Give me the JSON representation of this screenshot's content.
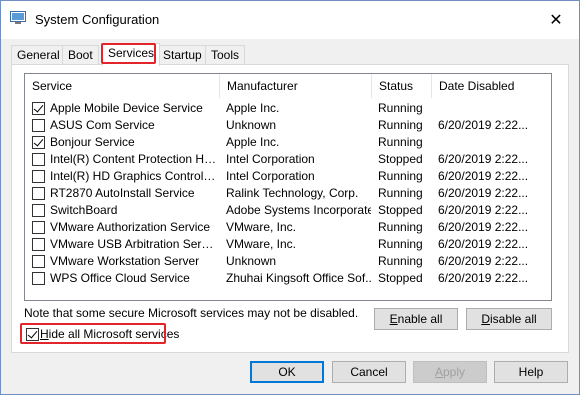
{
  "window": {
    "title": "System Configuration",
    "close_glyph": "✕"
  },
  "tabs": [
    {
      "label": "General",
      "active": false
    },
    {
      "label": "Boot",
      "active": false
    },
    {
      "label": "Services",
      "active": true
    },
    {
      "label": "Startup",
      "active": false
    },
    {
      "label": "Tools",
      "active": false
    }
  ],
  "services": {
    "columns": {
      "service": "Service",
      "manufacturer": "Manufacturer",
      "status": "Status",
      "date_disabled": "Date Disabled"
    },
    "rows": [
      {
        "checked": true,
        "name": "Apple Mobile Device Service",
        "manufacturer": "Apple Inc.",
        "status": "Running",
        "date": ""
      },
      {
        "checked": false,
        "name": "ASUS Com Service",
        "manufacturer": "Unknown",
        "status": "Running",
        "date": "6/20/2019 2:22..."
      },
      {
        "checked": true,
        "name": "Bonjour Service",
        "manufacturer": "Apple Inc.",
        "status": "Running",
        "date": ""
      },
      {
        "checked": false,
        "name": "Intel(R) Content Protection HEC...",
        "manufacturer": "Intel Corporation",
        "status": "Stopped",
        "date": "6/20/2019 2:22..."
      },
      {
        "checked": false,
        "name": "Intel(R) HD Graphics Control Pa...",
        "manufacturer": "Intel Corporation",
        "status": "Running",
        "date": "6/20/2019 2:22..."
      },
      {
        "checked": false,
        "name": "RT2870 AutoInstall Service",
        "manufacturer": "Ralink Technology, Corp.",
        "status": "Running",
        "date": "6/20/2019 2:22..."
      },
      {
        "checked": false,
        "name": "SwitchBoard",
        "manufacturer": "Adobe Systems Incorporated",
        "status": "Stopped",
        "date": "6/20/2019 2:22..."
      },
      {
        "checked": false,
        "name": "VMware Authorization Service",
        "manufacturer": "VMware, Inc.",
        "status": "Running",
        "date": "6/20/2019 2:22..."
      },
      {
        "checked": false,
        "name": "VMware USB Arbitration Service",
        "manufacturer": "VMware, Inc.",
        "status": "Running",
        "date": "6/20/2019 2:22..."
      },
      {
        "checked": false,
        "name": "VMware Workstation Server",
        "manufacturer": "Unknown",
        "status": "Running",
        "date": "6/20/2019 2:22..."
      },
      {
        "checked": false,
        "name": "WPS Office Cloud Service",
        "manufacturer": "Zhuhai Kingsoft Office Sof...",
        "status": "Stopped",
        "date": "6/20/2019 2:22..."
      }
    ]
  },
  "note": "Note that some secure Microsoft services may not be disabled.",
  "buttons": {
    "enable_all_accel": "E",
    "enable_all_rest": "nable all",
    "disable_all_accel": "D",
    "disable_all_rest": "isable all"
  },
  "hide_ms": {
    "checked": true,
    "accel": "H",
    "rest": "ide all Microsoft services"
  },
  "footer": {
    "ok": "OK",
    "cancel": "Cancel",
    "apply_accel": "A",
    "apply_rest": "pply",
    "help": "Help"
  },
  "colors": {
    "highlight": "#e3242b",
    "ok_border": "#0078d7"
  },
  "icons": {
    "app": "system-configuration-icon",
    "close": "close-icon",
    "check": "checkmark-icon"
  }
}
